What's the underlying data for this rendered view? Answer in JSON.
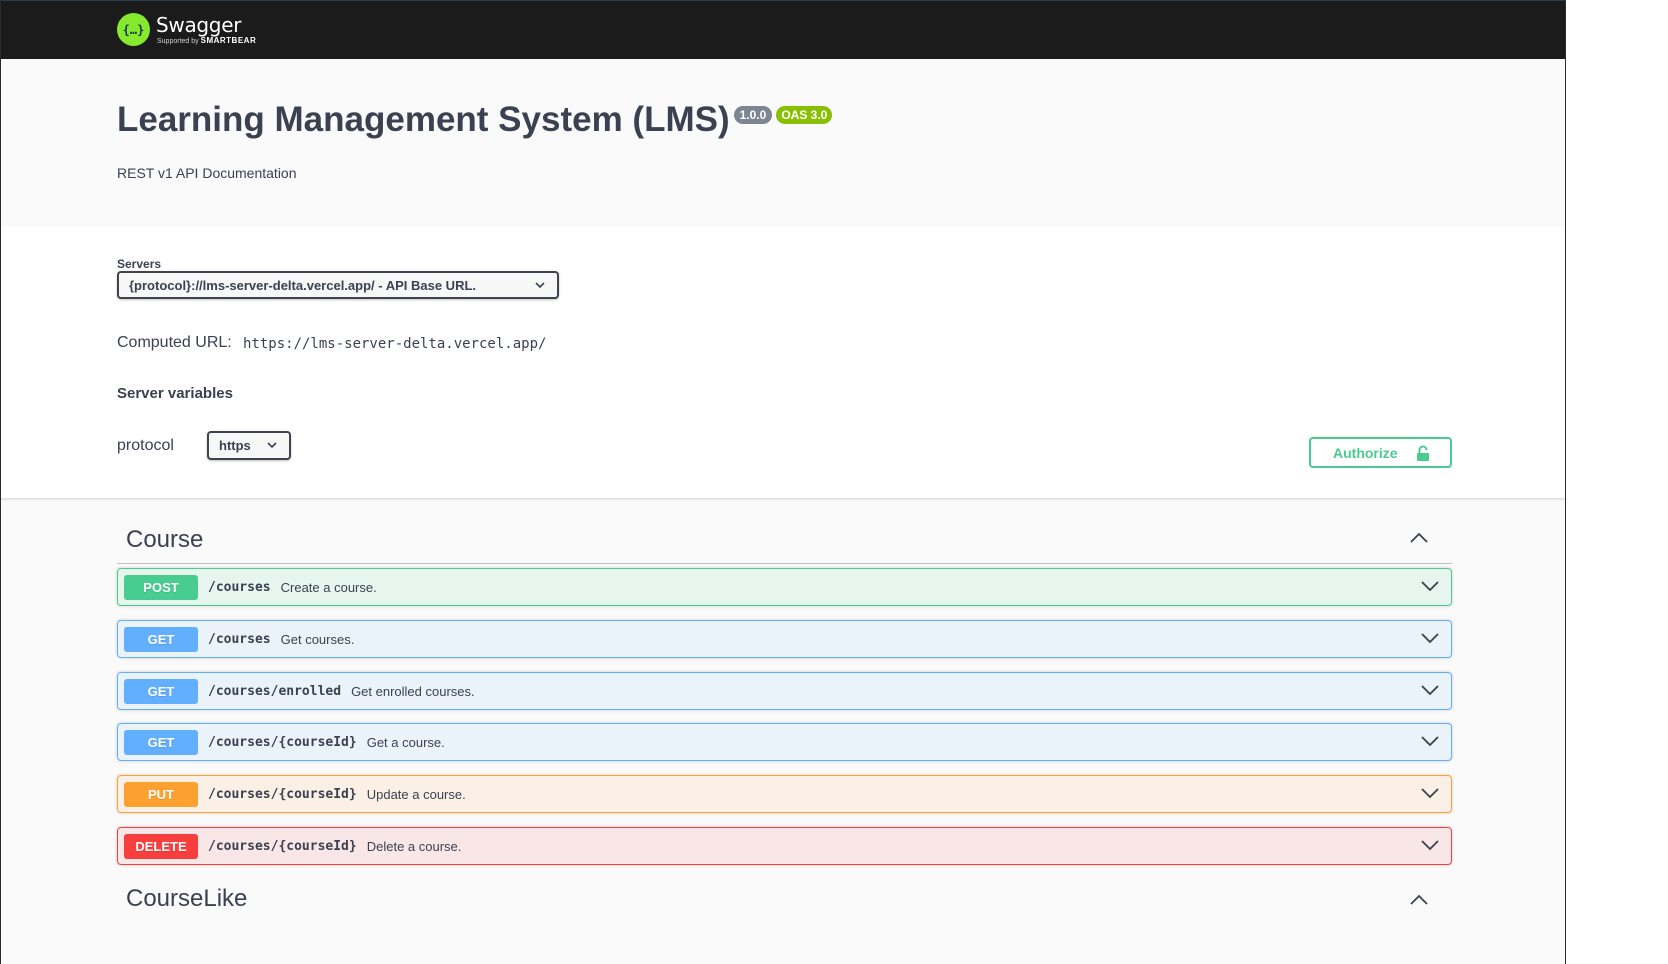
{
  "topbar": {
    "logo_icon": "{…}",
    "logo_name": "Swagger",
    "logo_sub_prefix": "Supported by",
    "logo_sub_brand": "SMARTBEAR"
  },
  "info": {
    "title": "Learning Management System (LMS)",
    "version": "1.0.0",
    "oas": "OAS 3.0",
    "description": "REST v1 API Documentation"
  },
  "servers": {
    "label": "Servers",
    "selected": "{protocol}://lms-server-delta.vercel.app/ - API Base URL.",
    "computed_label": "Computed URL:",
    "computed_url": "https://lms-server-delta.vercel.app/",
    "variables_title": "Server variables",
    "variable_name": "protocol",
    "variable_value": "https"
  },
  "authorize": {
    "label": "Authorize",
    "icon": "lock-icon"
  },
  "tags": [
    {
      "name": "Course",
      "operations": [
        {
          "method": "POST",
          "path": "/courses",
          "summary": "Create a course."
        },
        {
          "method": "GET",
          "path": "/courses",
          "summary": "Get courses."
        },
        {
          "method": "GET",
          "path": "/courses/enrolled",
          "summary": "Get enrolled courses."
        },
        {
          "method": "GET",
          "path": "/courses/{courseId}",
          "summary": "Get a course."
        },
        {
          "method": "PUT",
          "path": "/courses/{courseId}",
          "summary": "Update a course."
        },
        {
          "method": "DELETE",
          "path": "/courses/{courseId}",
          "summary": "Delete a course."
        }
      ]
    },
    {
      "name": "CourseLike"
    }
  ],
  "colors": {
    "post": "#49cc90",
    "get": "#61affe",
    "put": "#fca130",
    "delete": "#f93e3e",
    "topbar": "#1b1b1b",
    "logo": "#85ea2d",
    "oas_badge": "#89bf04",
    "version_badge": "#7d8492"
  }
}
